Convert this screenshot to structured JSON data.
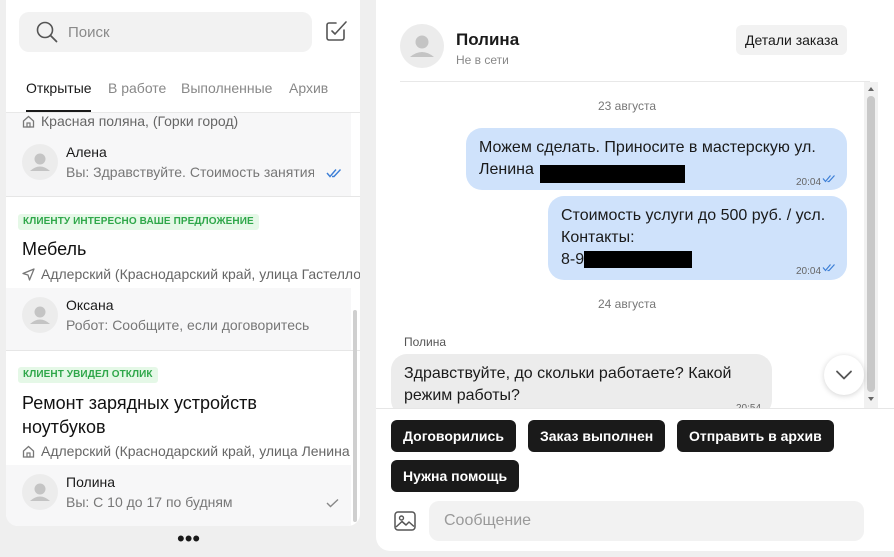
{
  "search": {
    "placeholder": "Поиск"
  },
  "tabs": [
    {
      "label": "Открытые",
      "active": true
    },
    {
      "label": "В работе"
    },
    {
      "label": "Выполненные"
    },
    {
      "label": "Архив"
    }
  ],
  "orders": [
    {
      "location": "Красная поляна, (Горки город)",
      "chat": {
        "name": "Алена",
        "last_message": "Вы: Здравствуйте. Стоимость занятия",
        "read": true
      }
    },
    {
      "badge": "КЛИЕНТУ ИНТЕРЕСНО ВАШЕ ПРЕДЛОЖЕНИЕ",
      "title": "Мебель",
      "location": "Адлерский (Краснодарский край, улица Гастелло",
      "chat": {
        "name": "Оксана",
        "last_message": "Робот: Сообщите, если договоритесь разм"
      }
    },
    {
      "badge": "КЛИЕНТ УВИДЕЛ ОТКЛИК",
      "title_lines": [
        "Ремонт зарядных устройств",
        "ноутбуков"
      ],
      "location": "Адлерский (Краснодарский край, улица Ленина",
      "chat": {
        "name": "Полина",
        "last_message": "Вы: С 10 до 17 по будням",
        "read": false
      }
    }
  ],
  "more_label": "•••",
  "chat": {
    "name": "Полина",
    "status": "Не в сети",
    "order_details_label": "Детали заказа",
    "messages": [
      {
        "type": "date",
        "text": "23 августа"
      },
      {
        "type": "outgoing",
        "lines": [
          "Можем сделать. Приносите в мастерскую ул.",
          "Ленина"
        ],
        "time": "20:04",
        "read": true
      },
      {
        "type": "outgoing",
        "lines": [
          "Стоимость услуги до 500 руб. / усл.",
          "Контакты:",
          "8-9"
        ],
        "time": "20:04",
        "read": true
      },
      {
        "type": "date",
        "text": "24 августа"
      },
      {
        "type": "incoming",
        "sender": "Полина",
        "lines": [
          "Здравствуйте, до скольки работаете? Какой",
          "режим работы?"
        ],
        "time": "20:54"
      }
    ],
    "quick_actions": [
      "Договорились",
      "Заказ выполнен",
      "Отправить в архив",
      "Нужна помощь"
    ],
    "input_placeholder": "Сообщение"
  },
  "colors": {
    "accent_blue": "#3d7fd6",
    "bubble_outgoing": "#cfe2fb",
    "bubble_incoming": "#ececec",
    "badge_green": "#2fa74a",
    "badge_bg": "#e5f8e7"
  }
}
